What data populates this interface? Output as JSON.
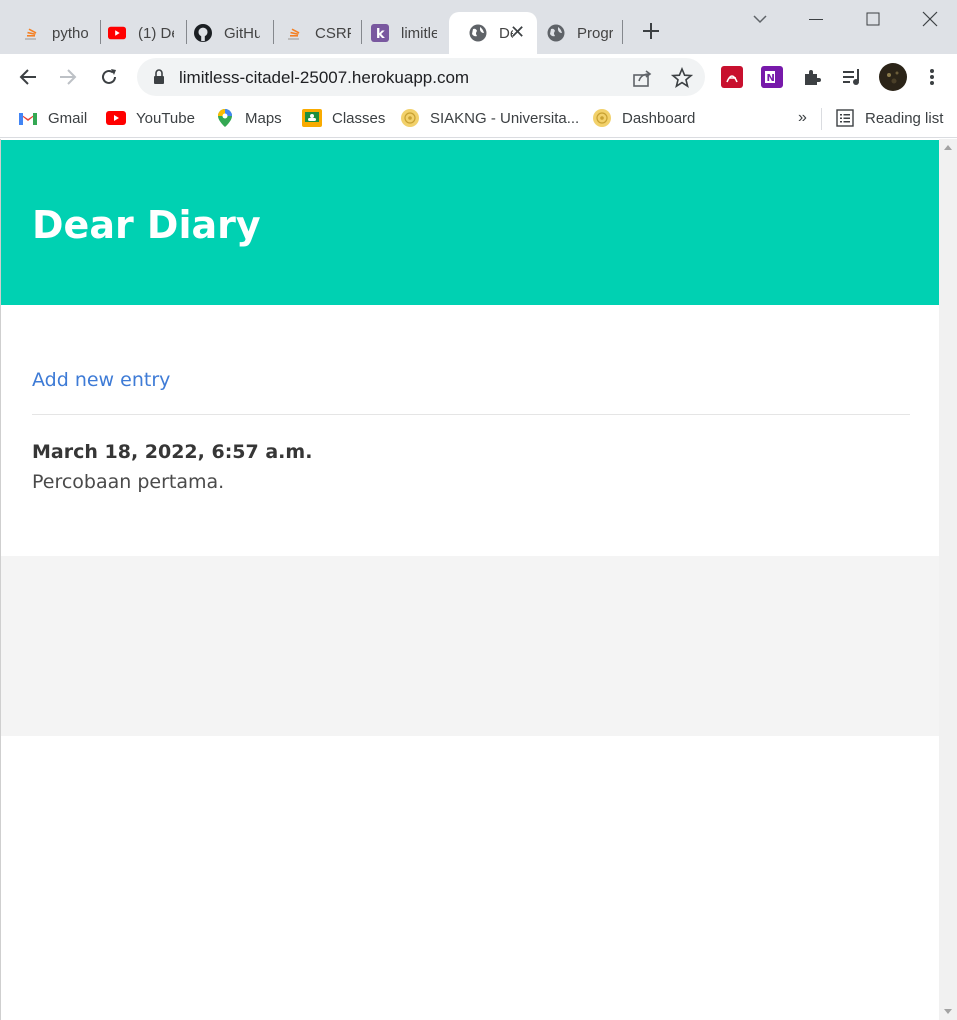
{
  "tabs": [
    {
      "title": "pytho",
      "icon": "stackoverflow-icon"
    },
    {
      "title": "(1) De",
      "icon": "youtube-icon"
    },
    {
      "title": "GitHu",
      "icon": "github-icon"
    },
    {
      "title": "CSRF",
      "icon": "stackoverflow-icon"
    },
    {
      "title": "limitle",
      "icon": "heroku-icon"
    },
    {
      "title": "De",
      "icon": "globe-icon",
      "active": true
    },
    {
      "title": "Progr",
      "icon": "globe-icon"
    }
  ],
  "address_bar": {
    "url": "limitless-citadel-25007.herokuapp.com"
  },
  "bookmarks": [
    {
      "label": "Gmail",
      "icon": "gmail-icon"
    },
    {
      "label": "YouTube",
      "icon": "youtube-icon"
    },
    {
      "label": "Maps",
      "icon": "maps-icon"
    },
    {
      "label": "Classes",
      "icon": "classroom-icon"
    },
    {
      "label": "SIAKNG - Universita...",
      "icon": "university-icon"
    },
    {
      "label": "Dashboard",
      "icon": "university-icon"
    }
  ],
  "bookmarks_overflow": "»",
  "reading_list": "Reading list",
  "page": {
    "hero_title": "Dear Diary",
    "add_entry_link": "Add new entry",
    "entries": [
      {
        "date": "March 18, 2022, 6:57 a.m.",
        "text": "Percobaan pertama."
      }
    ]
  },
  "colors": {
    "hero_bg": "#00d1b2",
    "link": "#3e7bd6",
    "footer_bg": "#f4f4f4"
  }
}
